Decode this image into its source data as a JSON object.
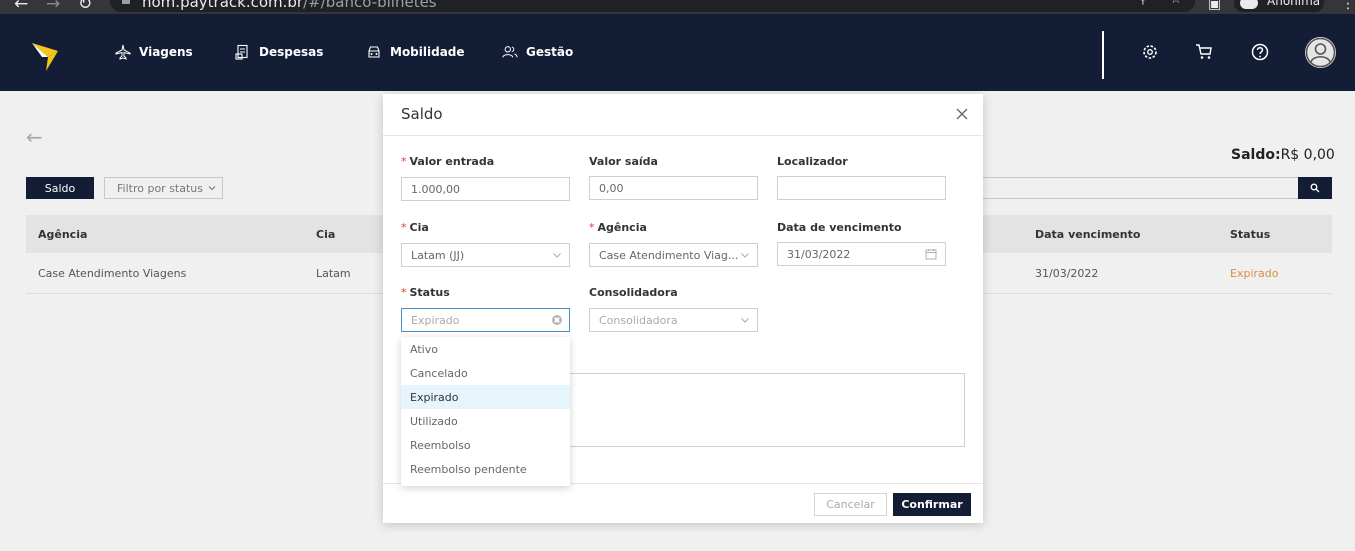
{
  "browser": {
    "url_host": "hom.paytrack.com.br",
    "url_path": "/#/banco-bilhetes",
    "profile_label": "Anônima"
  },
  "header": {
    "nav": [
      {
        "label": "Viagens",
        "icon": "airplane-icon"
      },
      {
        "label": "Despesas",
        "icon": "receipt-icon"
      },
      {
        "label": "Mobilidade",
        "icon": "car-icon"
      },
      {
        "label": "Gestão",
        "icon": "users-icon"
      }
    ],
    "colors": {
      "bg": "#131d35",
      "logo": "#f5c518"
    }
  },
  "page": {
    "saldo_label": "Saldo:",
    "saldo_value": "R$ 0,00",
    "saldo_button": "Saldo",
    "filter_status": "Filtro por status",
    "table": {
      "headers": [
        "Agência",
        "Cia",
        "Data vencimento",
        "Status"
      ],
      "rows": [
        {
          "agencia": "Case Atendimento Viagens",
          "cia": "Latam",
          "data_vencimento": "31/03/2022",
          "status": "Expirado"
        }
      ]
    }
  },
  "modal": {
    "title": "Saldo",
    "fields": {
      "valor_entrada": {
        "label": "Valor entrada",
        "value": "1.000,00"
      },
      "valor_saida": {
        "label": "Valor saída",
        "value": "0,00"
      },
      "localizador": {
        "label": "Localizador",
        "value": ""
      },
      "cia": {
        "label": "Cia",
        "value": "Latam (JJ)"
      },
      "agencia": {
        "label": "Agência",
        "value": "Case Atendimento Viag..."
      },
      "data_vencimento": {
        "label": "Data de vencimento",
        "value": "31/03/2022"
      },
      "status": {
        "label": "Status",
        "placeholder": "Expirado"
      },
      "consolidadora": {
        "label": "Consolidadora",
        "placeholder": "Consolidadora"
      }
    },
    "status_options": [
      "Ativo",
      "Cancelado",
      "Expirado",
      "Utilizado",
      "Reembolso",
      "Reembolso pendente"
    ],
    "status_highlighted": "Expirado",
    "cancel_label": "Cancelar",
    "confirm_label": "Confirmar"
  }
}
